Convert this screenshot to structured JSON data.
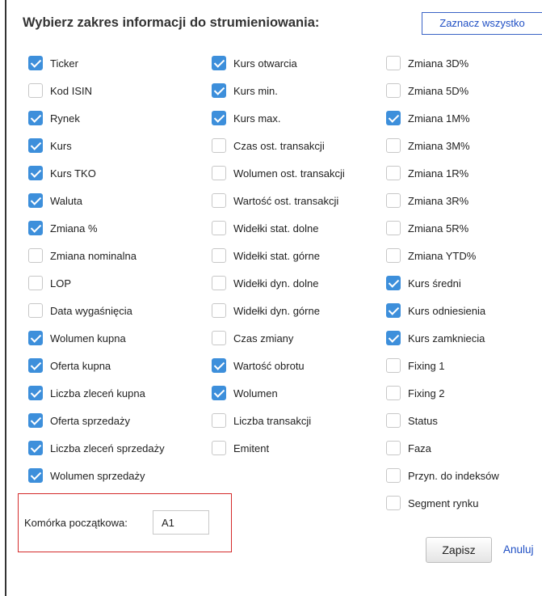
{
  "header": {
    "title": "Wybierz zakres informacji do strumieniowania:",
    "select_all_label": "Zaznacz wszystko"
  },
  "columns": [
    [
      {
        "label": "Ticker",
        "checked": true
      },
      {
        "label": "Kod ISIN",
        "checked": false
      },
      {
        "label": "Rynek",
        "checked": true
      },
      {
        "label": "Kurs",
        "checked": true
      },
      {
        "label": "Kurs TKO",
        "checked": true
      },
      {
        "label": "Waluta",
        "checked": true
      },
      {
        "label": "Zmiana %",
        "checked": true
      },
      {
        "label": "Zmiana nominalna",
        "checked": false
      },
      {
        "label": "LOP",
        "checked": false
      },
      {
        "label": "Data wygaśnięcia",
        "checked": false
      },
      {
        "label": "Wolumen kupna",
        "checked": true
      },
      {
        "label": "Oferta kupna",
        "checked": true
      },
      {
        "label": "Liczba zleceń kupna",
        "checked": true
      },
      {
        "label": "Oferta sprzedaży",
        "checked": true
      },
      {
        "label": "Liczba zleceń sprzedaży",
        "checked": true
      },
      {
        "label": "Wolumen sprzedaży",
        "checked": true
      }
    ],
    [
      {
        "label": "Kurs otwarcia",
        "checked": true
      },
      {
        "label": "Kurs min.",
        "checked": true
      },
      {
        "label": "Kurs max.",
        "checked": true
      },
      {
        "label": "Czas ost. transakcji",
        "checked": false
      },
      {
        "label": "Wolumen ost. transakcji",
        "checked": false
      },
      {
        "label": "Wartość ost. transakcji",
        "checked": false
      },
      {
        "label": "Widełki stat. dolne",
        "checked": false
      },
      {
        "label": "Widełki stat. górne",
        "checked": false
      },
      {
        "label": "Widełki dyn. dolne",
        "checked": false
      },
      {
        "label": "Widełki dyn. górne",
        "checked": false
      },
      {
        "label": "Czas zmiany",
        "checked": false
      },
      {
        "label": "Wartość obrotu",
        "checked": true
      },
      {
        "label": "Wolumen",
        "checked": true
      },
      {
        "label": "Liczba transakcji",
        "checked": false
      },
      {
        "label": "Emitent",
        "checked": false
      }
    ],
    [
      {
        "label": "Zmiana 3D%",
        "checked": false
      },
      {
        "label": "Zmiana 5D%",
        "checked": false
      },
      {
        "label": "Zmiana 1M%",
        "checked": true
      },
      {
        "label": "Zmiana 3M%",
        "checked": false
      },
      {
        "label": "Zmiana 1R%",
        "checked": false
      },
      {
        "label": "Zmiana 3R%",
        "checked": false
      },
      {
        "label": "Zmiana 5R%",
        "checked": false
      },
      {
        "label": "Zmiana YTD%",
        "checked": false
      },
      {
        "label": "Kurs średni",
        "checked": true
      },
      {
        "label": "Kurs odniesienia",
        "checked": true
      },
      {
        "label": "Kurs zamkniecia",
        "checked": true
      },
      {
        "label": "Fixing 1",
        "checked": false
      },
      {
        "label": "Fixing 2",
        "checked": false
      },
      {
        "label": "Status",
        "checked": false
      },
      {
        "label": "Faza",
        "checked": false
      },
      {
        "label": "Przyn. do indeksów",
        "checked": false
      },
      {
        "label": "Segment rynku",
        "checked": false
      }
    ]
  ],
  "start_cell": {
    "label": "Komórka początkowa:",
    "value": "A1"
  },
  "footer": {
    "save_label": "Zapisz",
    "cancel_label": "Anuluj"
  },
  "colors": {
    "checkbox_checked": "#3d8fdb",
    "link": "#1f4fc4",
    "highlight_border": "#d42a2a"
  }
}
